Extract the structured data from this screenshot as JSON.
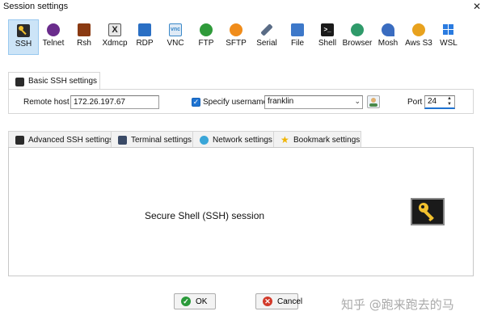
{
  "window": {
    "title": "Session settings"
  },
  "toolbar": {
    "items": [
      {
        "label": "SSH",
        "icon": "ssh-key-icon",
        "color": "#2b2b2b",
        "selected": true
      },
      {
        "label": "Telnet",
        "icon": "telnet-icon",
        "color": "#6a2c8c"
      },
      {
        "label": "Rsh",
        "icon": "rsh-icon",
        "color": "#8a3a12"
      },
      {
        "label": "Xdmcp",
        "icon": "xdmcp-icon",
        "color": "#333333"
      },
      {
        "label": "RDP",
        "icon": "rdp-monitor-icon",
        "color": "#2a6fc4"
      },
      {
        "label": "VNC",
        "icon": "vnc-icon",
        "color": "#3a88c8"
      },
      {
        "label": "FTP",
        "icon": "ftp-globe-icon",
        "color": "#2f9a3a"
      },
      {
        "label": "SFTP",
        "icon": "sftp-icon",
        "color": "#f08c1a"
      },
      {
        "label": "Serial",
        "icon": "serial-icon",
        "color": "#5a6c86"
      },
      {
        "label": "File",
        "icon": "file-icon",
        "color": "#3d78c9"
      },
      {
        "label": "Shell",
        "icon": "shell-terminal-icon",
        "color": "#1a1a1a"
      },
      {
        "label": "Browser",
        "icon": "browser-globe-icon",
        "color": "#2f9a6a"
      },
      {
        "label": "Mosh",
        "icon": "mosh-icon",
        "color": "#3a6cc0"
      },
      {
        "label": "Aws S3",
        "icon": "aws-s3-icon",
        "color": "#e8a21e"
      },
      {
        "label": "WSL",
        "icon": "wsl-windows-icon",
        "color": "#2a7be0"
      }
    ]
  },
  "basic": {
    "tab_label": "Basic SSH settings",
    "remote_host_label": "Remote host *",
    "remote_host_value": "172.26.197.67",
    "specify_username_label": "Specify username",
    "specify_username_checked": true,
    "username_value": "franklin",
    "port_label": "Port",
    "port_value": "24"
  },
  "tabs": [
    {
      "label": "Advanced SSH settings",
      "icon": "wrench-icon"
    },
    {
      "label": "Terminal settings",
      "icon": "terminal-icon"
    },
    {
      "label": "Network settings",
      "icon": "network-icon"
    },
    {
      "label": "Bookmark settings",
      "icon": "star-icon"
    }
  ],
  "main": {
    "description": "Secure Shell (SSH) session"
  },
  "buttons": {
    "ok_label": "OK",
    "cancel_label": "Cancel"
  },
  "watermark": "知乎 @跑来跑去的马"
}
